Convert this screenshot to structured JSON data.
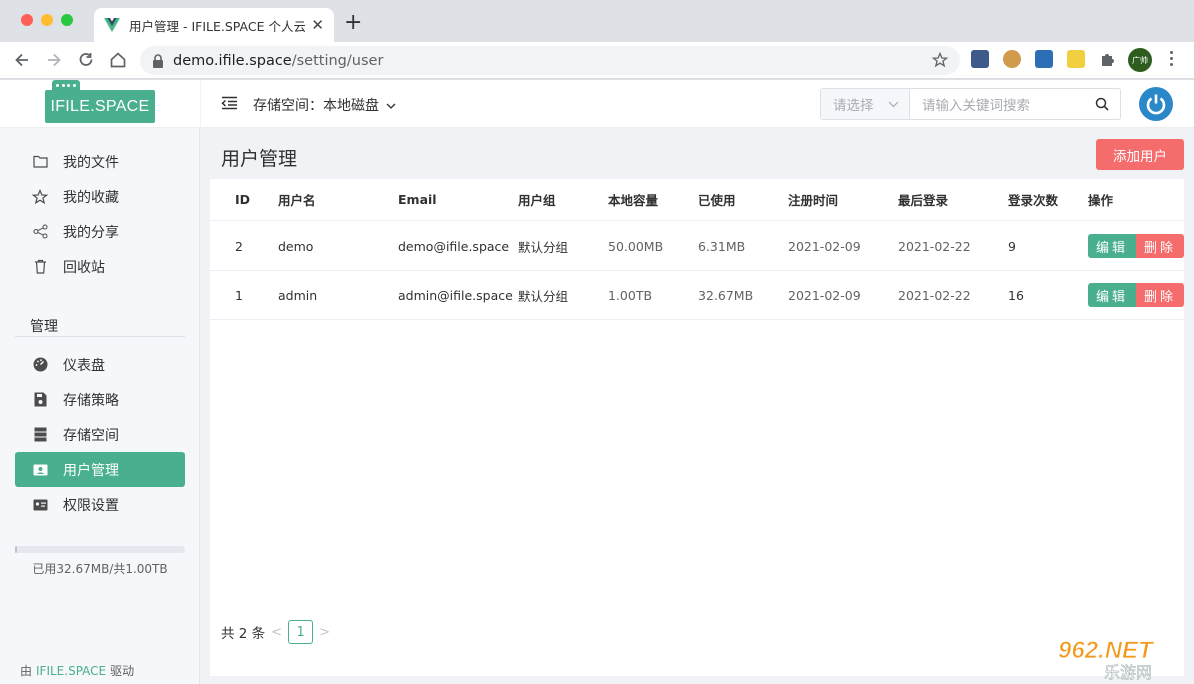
{
  "browser": {
    "tab_title": "用户管理 - IFILE.SPACE 个人云文",
    "tab_close": "✕",
    "new_tab": "+",
    "url_host": "demo.ifile.space",
    "url_path": "/setting/user",
    "profile_label": "广帅"
  },
  "app": {
    "logo": "IFILE.SPACE",
    "storage_label": "存储空间：",
    "storage_value": "本地磁盘",
    "search_select_placeholder": "请选择",
    "search_placeholder": "请输入关键词搜索"
  },
  "sidebar": {
    "items": [
      {
        "label": "我的文件",
        "icon": "folder-icon"
      },
      {
        "label": "我的收藏",
        "icon": "star-icon"
      },
      {
        "label": "我的分享",
        "icon": "share-icon"
      },
      {
        "label": "回收站",
        "icon": "trash-icon"
      }
    ],
    "group_label": "管理",
    "admin_items": [
      {
        "label": "仪表盘",
        "icon": "dashboard-icon"
      },
      {
        "label": "存储策略",
        "icon": "save-icon"
      },
      {
        "label": "存储空间",
        "icon": "server-icon"
      },
      {
        "label": "用户管理",
        "icon": "user-card-icon",
        "active": true
      },
      {
        "label": "权限设置",
        "icon": "id-card-icon"
      }
    ],
    "quota_text": "已用32.67MB/共1.00TB",
    "quota_fraction": 3e-05,
    "powered_prefix": "由",
    "powered_brand": "IFILE.SPACE",
    "powered_suffix": "驱动"
  },
  "page": {
    "title": "用户管理",
    "add_button": "添加用户"
  },
  "table": {
    "columns": [
      "ID",
      "用户名",
      "Email",
      "用户组",
      "本地容量",
      "已使用",
      "注册时间",
      "最后登录",
      "登录次数",
      "操作"
    ],
    "rows": [
      {
        "id": "2",
        "username": "demo",
        "email": "demo@ifile.space",
        "group": "默认分组",
        "capacity": "50.00MB",
        "used": "6.31MB",
        "registered": "2021-02-09",
        "last_login": "2021-02-22",
        "login_count": "9"
      },
      {
        "id": "1",
        "username": "admin",
        "email": "admin@ifile.space",
        "group": "默认分组",
        "capacity": "1.00TB",
        "used": "32.67MB",
        "registered": "2021-02-09",
        "last_login": "2021-02-22",
        "login_count": "16"
      }
    ],
    "edit_label": "编辑",
    "delete_label": "删除"
  },
  "pagination": {
    "total_text": "共 2 条",
    "current_page": "1",
    "prev": "<",
    "next": ">"
  },
  "watermark": {
    "top": "962.NET",
    "bottom": "乐游网"
  }
}
